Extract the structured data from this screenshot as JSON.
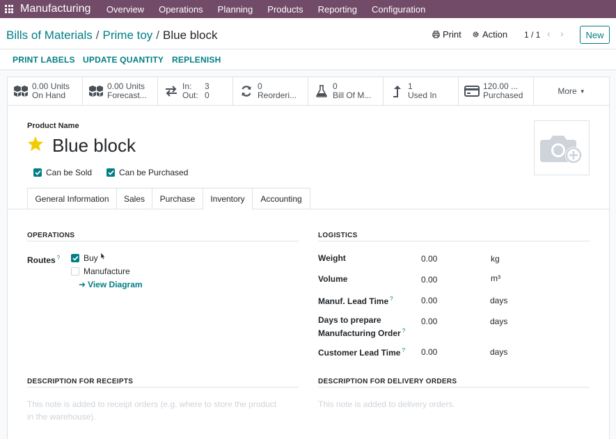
{
  "navbar": {
    "brand": "Manufacturing",
    "items": [
      "Overview",
      "Operations",
      "Planning",
      "Products",
      "Reporting",
      "Configuration"
    ],
    "color": "#714b67"
  },
  "breadcrumb": {
    "items": [
      "Bills of Materials",
      "Prime toy"
    ],
    "separator": "/",
    "current": "Blue block"
  },
  "control": {
    "print_label": "Print",
    "action_label": "Action",
    "pager": "1 / 1",
    "new_label": "New"
  },
  "actions": {
    "print_labels": "PRINT LABELS",
    "update_quantity": "UPDATE QUANTITY",
    "replenish": "REPLENISH"
  },
  "smart_buttons": {
    "on_hand": {
      "value": "0.00 Units",
      "label": "On Hand",
      "icon": "cubes-icon"
    },
    "forecasted": {
      "value": "0.00 Units",
      "label": "Forecast...",
      "icon": "cubes-icon"
    },
    "in_out": {
      "in_label": "In:",
      "in_value": "3",
      "out_label": "Out:",
      "out_value": "0",
      "icon": "exchange-icon"
    },
    "reordering": {
      "value": "0",
      "label": "Reorderi...",
      "icon": "refresh-icon"
    },
    "bom": {
      "value": "0",
      "label": "Bill Of M...",
      "icon": "flask-icon"
    },
    "used_in": {
      "value": "1",
      "label": "Used In",
      "icon": "level-up-icon"
    },
    "purchased": {
      "value": "120.00 ...",
      "label": "Purchased",
      "icon": "credit-card-icon"
    },
    "more": "More"
  },
  "product": {
    "name_label": "Product Name",
    "name": "Blue block",
    "can_be_sold_label": "Can be Sold",
    "can_be_sold": true,
    "can_be_purchased_label": "Can be Purchased",
    "can_be_purchased": true,
    "star_color": "#f3cc00"
  },
  "tabs": [
    "General Information",
    "Sales",
    "Purchase",
    "Inventory",
    "Accounting"
  ],
  "active_tab": "Inventory",
  "operations": {
    "title": "OPERATIONS",
    "routes_label": "Routes",
    "help_mark": "?",
    "routes": [
      {
        "label": "Buy",
        "checked": true
      },
      {
        "label": "Manufacture",
        "checked": false
      }
    ],
    "view_diagram": "View Diagram"
  },
  "logistics": {
    "title": "LOGISTICS",
    "weight_label": "Weight",
    "weight_value": "0.00",
    "weight_unit": "kg",
    "volume_label": "Volume",
    "volume_value": "0.00",
    "volume_unit": "m³",
    "manuf_lead_label": "Manuf. Lead Time",
    "manuf_lead_value": "0.00",
    "manuf_lead_unit": "days",
    "days_prepare_label_1": "Days to prepare",
    "days_prepare_label_2": "Manufacturing Order",
    "days_prepare_value": "0.00",
    "days_prepare_unit": "days",
    "customer_lead_label": "Customer Lead Time",
    "customer_lead_value": "0.00",
    "customer_lead_unit": "days"
  },
  "receipts": {
    "title": "DESCRIPTION FOR RECEIPTS",
    "placeholder_1": "This note is added to receipt orders (e.g. where to store the product",
    "placeholder_2": "in the warehouse)."
  },
  "delivery": {
    "title": "DESCRIPTION FOR DELIVERY ORDERS",
    "placeholder": "This note is added to delivery orders."
  },
  "accent_color": "#017e84"
}
